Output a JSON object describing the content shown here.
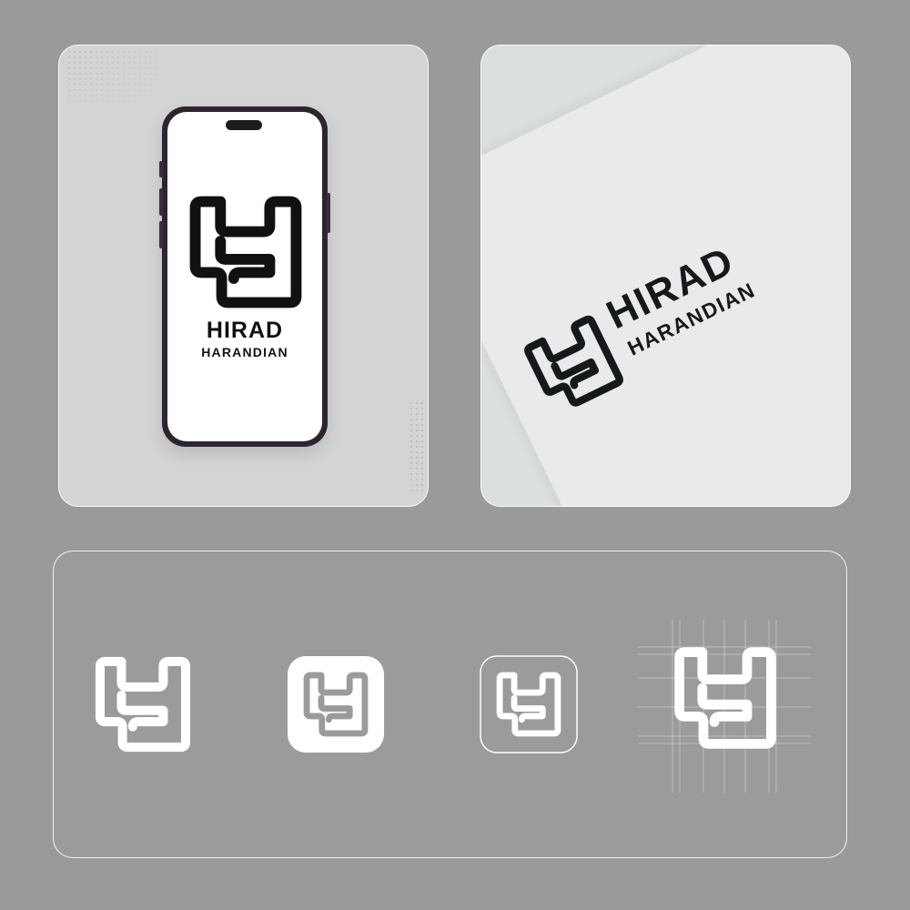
{
  "brand": {
    "name_line1": "HIRAD",
    "name_line2": "HARANDIAN"
  },
  "colors": {
    "background": "#999a9a",
    "panel_border": "#ffffff",
    "logo_dark": "#111111",
    "logo_light": "#ffffff",
    "phone_frame": "#2e2430"
  },
  "icons": [
    "monogram-h-logo"
  ]
}
